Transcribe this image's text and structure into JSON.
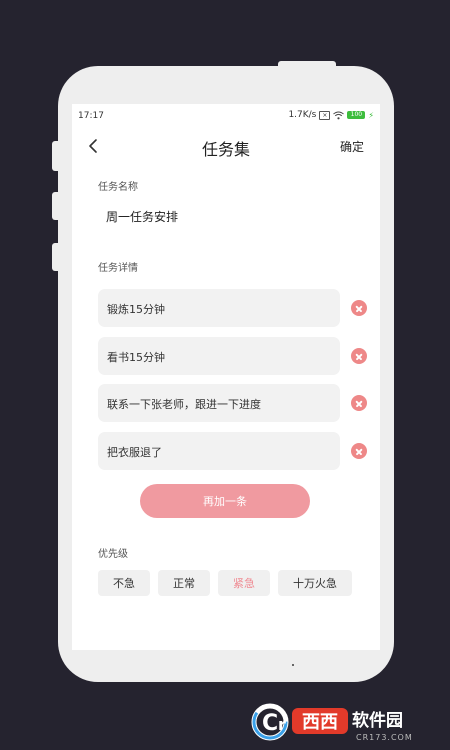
{
  "status": {
    "time": "17:17",
    "speed": "1.7K/s",
    "sim_icon_text": "×",
    "battery": "100"
  },
  "nav": {
    "title": "任务集",
    "confirm": "确定"
  },
  "form": {
    "name_label": "任务名称",
    "name_value": "周一任务安排",
    "detail_label": "任务详情",
    "tasks": [
      {
        "text": "锻炼15分钟"
      },
      {
        "text": "看书15分钟"
      },
      {
        "text": "联系一下张老师，跟进一下进度"
      },
      {
        "text": "把衣服退了"
      }
    ],
    "add_label": "再加一条",
    "priority_label": "优先级",
    "priorities": [
      {
        "label": "不急",
        "active": false
      },
      {
        "label": "正常",
        "active": false
      },
      {
        "label": "紧急",
        "active": true
      },
      {
        "label": "十万火急",
        "active": false
      }
    ]
  },
  "colors": {
    "background": "#25232f",
    "accent": "#f09aa0",
    "delete": "#ee8888",
    "active_priority": "#ef8a92"
  },
  "watermark": {
    "brand_a": "西西",
    "brand_b": "软件园",
    "url": "CR173.COM"
  }
}
